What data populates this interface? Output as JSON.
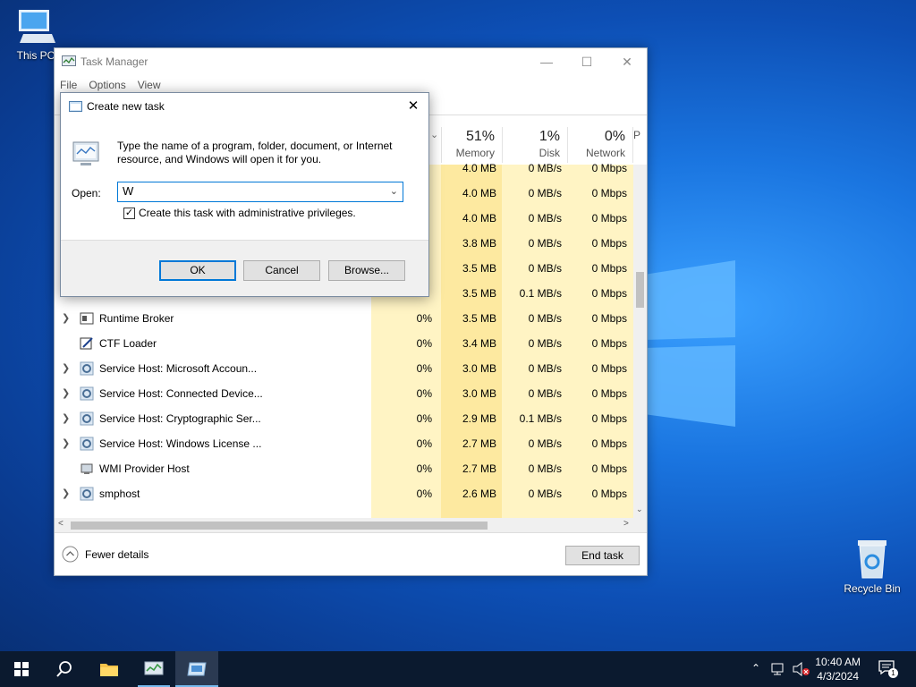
{
  "desktop": {
    "this_pc_label": "This PC",
    "recycle_bin_label": "Recycle Bin"
  },
  "task_manager": {
    "title": "Task Manager",
    "menu": [
      "File",
      "Options",
      "View"
    ],
    "columns": [
      {
        "pct": "51%",
        "name": "Memory"
      },
      {
        "pct": "1%",
        "name": "Disk"
      },
      {
        "pct": "0%",
        "name": "Network"
      },
      {
        "pct": "",
        "name": "P"
      }
    ],
    "partial_rows": [
      {
        "cpu": "",
        "mem": "4.0 MB",
        "disk": "0 MB/s",
        "net": "0 Mbps"
      },
      {
        "cpu": "",
        "mem": "4.0 MB",
        "disk": "0 MB/s",
        "net": "0 Mbps"
      },
      {
        "cpu": "",
        "mem": "4.0 MB",
        "disk": "0 MB/s",
        "net": "0 Mbps"
      },
      {
        "cpu": "",
        "mem": "3.8 MB",
        "disk": "0 MB/s",
        "net": "0 Mbps"
      },
      {
        "cpu": "",
        "mem": "3.5 MB",
        "disk": "0 MB/s",
        "net": "0 Mbps"
      },
      {
        "cpu": "",
        "mem": "3.5 MB",
        "disk": "0.1 MB/s",
        "net": "0 Mbps"
      }
    ],
    "rows": [
      {
        "expand": true,
        "icon": "window-icon",
        "name": "Runtime Broker",
        "cpu": "0%",
        "mem": "3.5 MB",
        "disk": "0 MB/s",
        "net": "0 Mbps"
      },
      {
        "expand": false,
        "icon": "pen-icon",
        "name": "CTF Loader",
        "cpu": "0%",
        "mem": "3.4 MB",
        "disk": "0 MB/s",
        "net": "0 Mbps"
      },
      {
        "expand": true,
        "icon": "gear-icon",
        "name": "Service Host: Microsoft Accoun...",
        "cpu": "0%",
        "mem": "3.0 MB",
        "disk": "0 MB/s",
        "net": "0 Mbps"
      },
      {
        "expand": true,
        "icon": "gear-icon",
        "name": "Service Host: Connected Device...",
        "cpu": "0%",
        "mem": "3.0 MB",
        "disk": "0 MB/s",
        "net": "0 Mbps"
      },
      {
        "expand": true,
        "icon": "gear-icon",
        "name": "Service Host: Cryptographic Ser...",
        "cpu": "0%",
        "mem": "2.9 MB",
        "disk": "0.1 MB/s",
        "net": "0 Mbps"
      },
      {
        "expand": true,
        "icon": "gear-icon",
        "name": "Service Host: Windows License ...",
        "cpu": "0%",
        "mem": "2.7 MB",
        "disk": "0 MB/s",
        "net": "0 Mbps"
      },
      {
        "expand": false,
        "icon": "wmi-icon",
        "name": "WMI Provider Host",
        "cpu": "0%",
        "mem": "2.7 MB",
        "disk": "0 MB/s",
        "net": "0 Mbps"
      },
      {
        "expand": true,
        "icon": "gear-icon",
        "name": "smphost",
        "cpu": "0%",
        "mem": "2.6 MB",
        "disk": "0 MB/s",
        "net": "0 Mbps"
      }
    ],
    "fewer_details": "Fewer details",
    "end_task": "End task"
  },
  "dialog": {
    "title": "Create new task",
    "description": "Type the name of a program, folder, document, or Internet resource, and Windows will open it for you.",
    "open_label": "Open:",
    "open_value": "W",
    "admin_checkbox_label": "Create this task with administrative privileges.",
    "admin_checked": true,
    "ok": "OK",
    "cancel": "Cancel",
    "browse": "Browse..."
  },
  "taskbar": {
    "time": "10:40 AM",
    "date": "4/3/2024",
    "notification_count": "1"
  },
  "colors": {
    "accent": "#0078d7",
    "heat_cell": "#fff4c4",
    "heat_cell_strong": "#fde9a0",
    "taskbar": "#0b1a2f"
  }
}
